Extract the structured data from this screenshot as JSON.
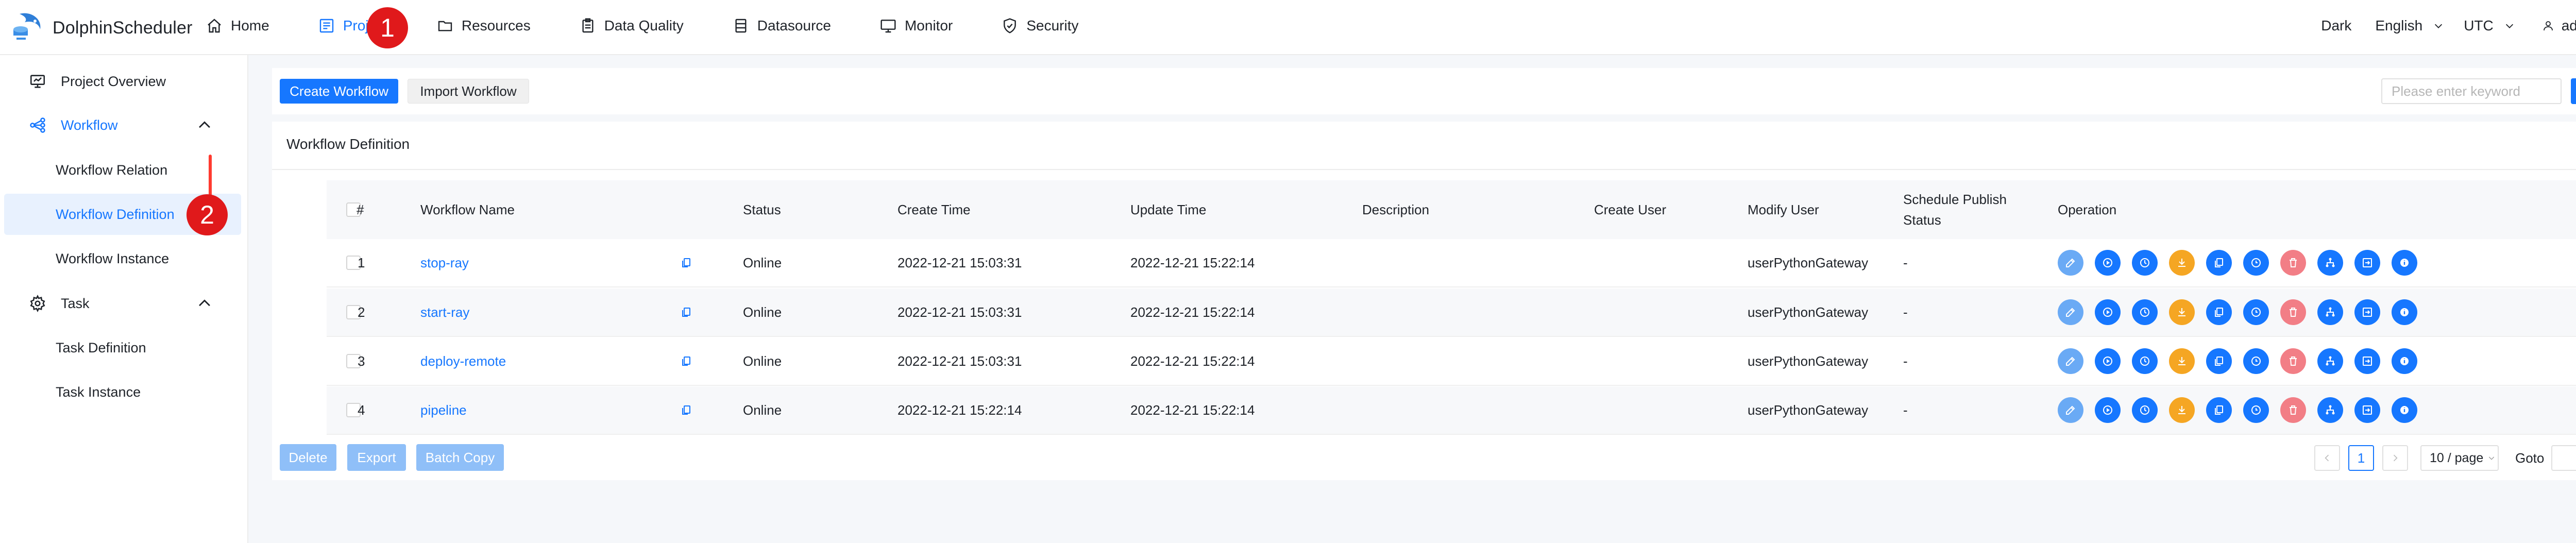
{
  "app": {
    "name": "DolphinScheduler"
  },
  "nav": {
    "items": [
      {
        "label": "Home",
        "icon": "home-icon"
      },
      {
        "label": "Project",
        "icon": "project-icon",
        "active": true
      },
      {
        "label": "Resources",
        "icon": "folder-icon"
      },
      {
        "label": "Data Quality",
        "icon": "clipboard-icon"
      },
      {
        "label": "Datasource",
        "icon": "database-icon"
      },
      {
        "label": "Monitor",
        "icon": "monitor-icon"
      },
      {
        "label": "Security",
        "icon": "shield-icon"
      }
    ],
    "theme": "Dark",
    "language": "English",
    "timezone": "UTC",
    "user": "admin"
  },
  "markers": {
    "one": "1",
    "two": "2"
  },
  "sidebar": {
    "items": [
      {
        "label": "Project Overview"
      },
      {
        "label": "Workflow"
      },
      {
        "label": "Workflow Relation"
      },
      {
        "label": "Workflow Definition"
      },
      {
        "label": "Workflow Instance"
      },
      {
        "label": "Task"
      },
      {
        "label": "Task Definition"
      },
      {
        "label": "Task Instance"
      }
    ]
  },
  "toolbar": {
    "create_label": "Create Workflow",
    "import_label": "Import Workflow",
    "search_placeholder": "Please enter keyword"
  },
  "card": {
    "title": "Workflow Definition"
  },
  "table": {
    "headers": {
      "index": "#",
      "name": "Workflow Name",
      "status": "Status",
      "create_time": "Create Time",
      "update_time": "Update Time",
      "description": "Description",
      "create_user": "Create User",
      "modify_user": "Modify User",
      "schedule": "Schedule Publish Status",
      "operation": "Operation"
    },
    "rows": [
      {
        "index": "1",
        "name": "stop-ray",
        "status": "Online",
        "create_time": "2022-12-21 15:03:31",
        "update_time": "2022-12-21 15:22:14",
        "description": "",
        "create_user": "",
        "modify_user": "userPythonGateway",
        "schedule": "-"
      },
      {
        "index": "2",
        "name": "start-ray",
        "status": "Online",
        "create_time": "2022-12-21 15:03:31",
        "update_time": "2022-12-21 15:22:14",
        "description": "",
        "create_user": "",
        "modify_user": "userPythonGateway",
        "schedule": "-"
      },
      {
        "index": "3",
        "name": "deploy-remote",
        "status": "Online",
        "create_time": "2022-12-21 15:03:31",
        "update_time": "2022-12-21 15:22:14",
        "description": "",
        "create_user": "",
        "modify_user": "userPythonGateway",
        "schedule": "-"
      },
      {
        "index": "4",
        "name": "pipeline",
        "status": "Online",
        "create_time": "2022-12-21 15:22:14",
        "update_time": "2022-12-21 15:22:14",
        "description": "",
        "create_user": "",
        "modify_user": "userPythonGateway",
        "schedule": "-"
      }
    ]
  },
  "footer": {
    "delete_label": "Delete",
    "export_label": "Export",
    "batch_copy_label": "Batch Copy"
  },
  "pagination": {
    "current_page": "1",
    "page_size": "10 / page",
    "goto_label": "Goto"
  },
  "colors": {
    "primary": "#1677ff",
    "warning": "#f5a623",
    "danger": "#f27e86",
    "marker": "#e0191b"
  }
}
